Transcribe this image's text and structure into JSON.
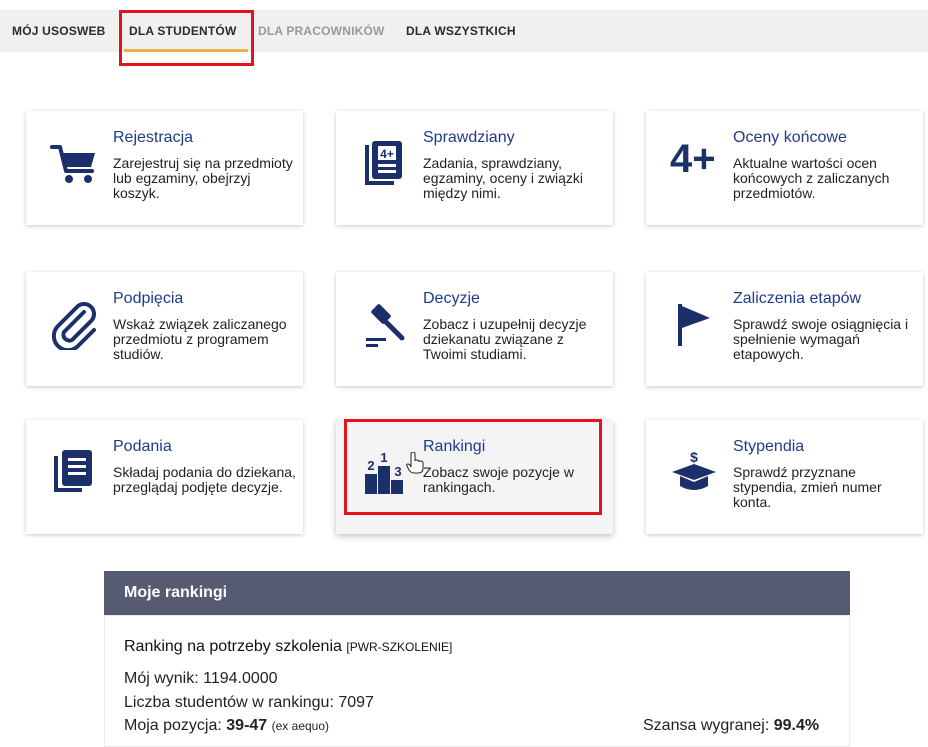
{
  "nav": {
    "tabs": [
      {
        "label": "MÓJ USOSWEB",
        "active": false
      },
      {
        "label": "DLA STUDENTÓW",
        "active": true
      },
      {
        "label": "DLA PRACOWNIKÓW",
        "active": false
      },
      {
        "label": "DLA WSZYSTKICH",
        "active": false
      }
    ]
  },
  "tiles": [
    {
      "title": "Rejestracja",
      "desc": "Zarejestruj się na przedmioty lub egzaminy, obejrzyj koszyk.",
      "icon": "shopping-cart-icon"
    },
    {
      "title": "Sprawdziany",
      "desc": "Zadania, sprawdziany, egzaminy, oceny i związki między nimi.",
      "icon": "test-sheet-icon"
    },
    {
      "title": "Oceny końcowe",
      "desc": "Aktualne wartości ocen końcowych z zaliczanych przedmiotów.",
      "icon": "grade-four-plus-icon",
      "icon_text": "4+"
    },
    {
      "title": "Podpięcia",
      "desc": "Wskaż związek zaliczanego przedmiotu z programem studiów.",
      "icon": "paperclip-icon"
    },
    {
      "title": "Decyzje",
      "desc": "Zobacz i uzupełnij decyzje dziekanatu związane z Twoimi studiami.",
      "icon": "gavel-icon"
    },
    {
      "title": "Zaliczenia etapów",
      "desc": "Sprawdź swoje osiągnięcia i spełnienie wymagań etapowych.",
      "icon": "flag-icon"
    },
    {
      "title": "Podania",
      "desc": "Składaj podania do dziekana, przeglądaj podjęte decyzje.",
      "icon": "document-icon"
    },
    {
      "title": "Rankingi",
      "desc": "Zobacz swoje pozycje w rankingach.",
      "icon": "podium-icon",
      "icon_digits": [
        "2",
        "1",
        "3"
      ]
    },
    {
      "title": "Stypendia",
      "desc": "Sprawdź przyznane stypendia, zmień numer konta.",
      "icon": "graduation-cap-dollar-icon",
      "icon_text": "$"
    }
  ],
  "panel": {
    "title": "Moje rankingi",
    "ranking_name": "Ranking na potrzeby szkolenia",
    "ranking_code": "[PWR-SZKOLENIE]",
    "score_label": "Mój wynik: ",
    "score_value": "1194.0000",
    "students_label": "Liczba studentów w rankingu: ",
    "students_value": "7097",
    "position_label": "Moja pozycja: ",
    "position_value": "39-47",
    "position_note": "(ex aequo)",
    "chance_label": "Szansa wygranej: ",
    "chance_value": "99.4%"
  },
  "colors": {
    "icon_navy": "#1b2f6b",
    "title_blue": "#1f3a8a",
    "highlight_red": "#e0161e",
    "tab_underline": "#e8b24a",
    "panel_header": "#575b72"
  }
}
